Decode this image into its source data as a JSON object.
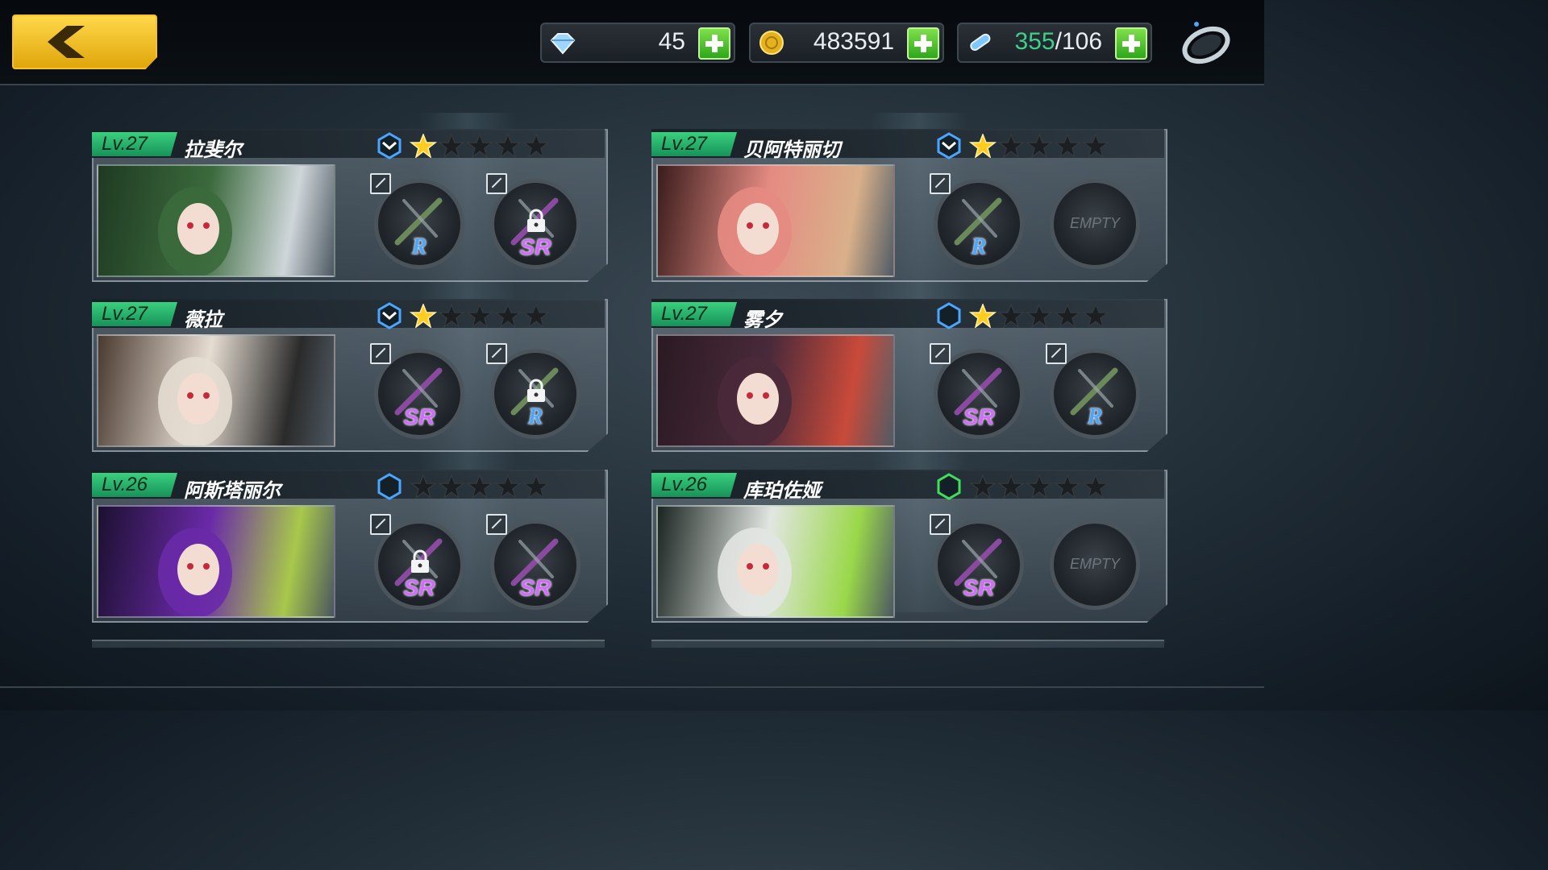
{
  "resources": [
    {
      "icon": "crystal-icon",
      "value": "45"
    },
    {
      "icon": "gold-coin-icon",
      "value": "483591"
    },
    {
      "icon": "stamina-vial-icon",
      "value_current": "355",
      "value_max": "/106"
    }
  ],
  "colors": {
    "accent_level": "#2fbf74",
    "rarity_sr": "#d36bff",
    "rarity_r": "#4aa6ff",
    "star_on": "#ffcc22",
    "star_off": "#1c1f22"
  },
  "characters": [
    {
      "level": "Lv.27",
      "name": "拉斐尔",
      "rank_icon": "rank-chevron-blue-icon",
      "stars": 1,
      "slots": [
        {
          "rarity": "R",
          "locked": false
        },
        {
          "rarity": "SR",
          "locked": true
        }
      ]
    },
    {
      "level": "Lv.27",
      "name": "贝阿特丽切",
      "rank_icon": "rank-chevron-blue-icon",
      "stars": 1,
      "slots": [
        {
          "rarity": "R",
          "locked": false
        },
        {
          "empty": "EMPTY"
        }
      ]
    },
    {
      "level": "Lv.27",
      "name": "薇拉",
      "rank_icon": "rank-chevron-blue-icon",
      "stars": 1,
      "slots": [
        {
          "rarity": "SR",
          "locked": false
        },
        {
          "rarity": "R",
          "locked": true
        }
      ]
    },
    {
      "level": "Lv.27",
      "name": "雾夕",
      "rank_icon": "rank-hexagon-blue-icon",
      "stars": 1,
      "slots": [
        {
          "rarity": "SR",
          "locked": false
        },
        {
          "rarity": "R",
          "locked": false
        }
      ]
    },
    {
      "level": "Lv.26",
      "name": "阿斯塔丽尔",
      "rank_icon": "rank-hexagon-blue-icon",
      "stars": 0,
      "slots": [
        {
          "rarity": "SR",
          "locked": true
        },
        {
          "rarity": "SR",
          "locked": false
        }
      ]
    },
    {
      "level": "Lv.26",
      "name": "库珀佐娅",
      "rank_icon": "rank-hexagon-green-icon",
      "stars": 0,
      "slots": [
        {
          "rarity": "SR",
          "locked": false
        },
        {
          "empty": "EMPTY"
        }
      ]
    }
  ]
}
